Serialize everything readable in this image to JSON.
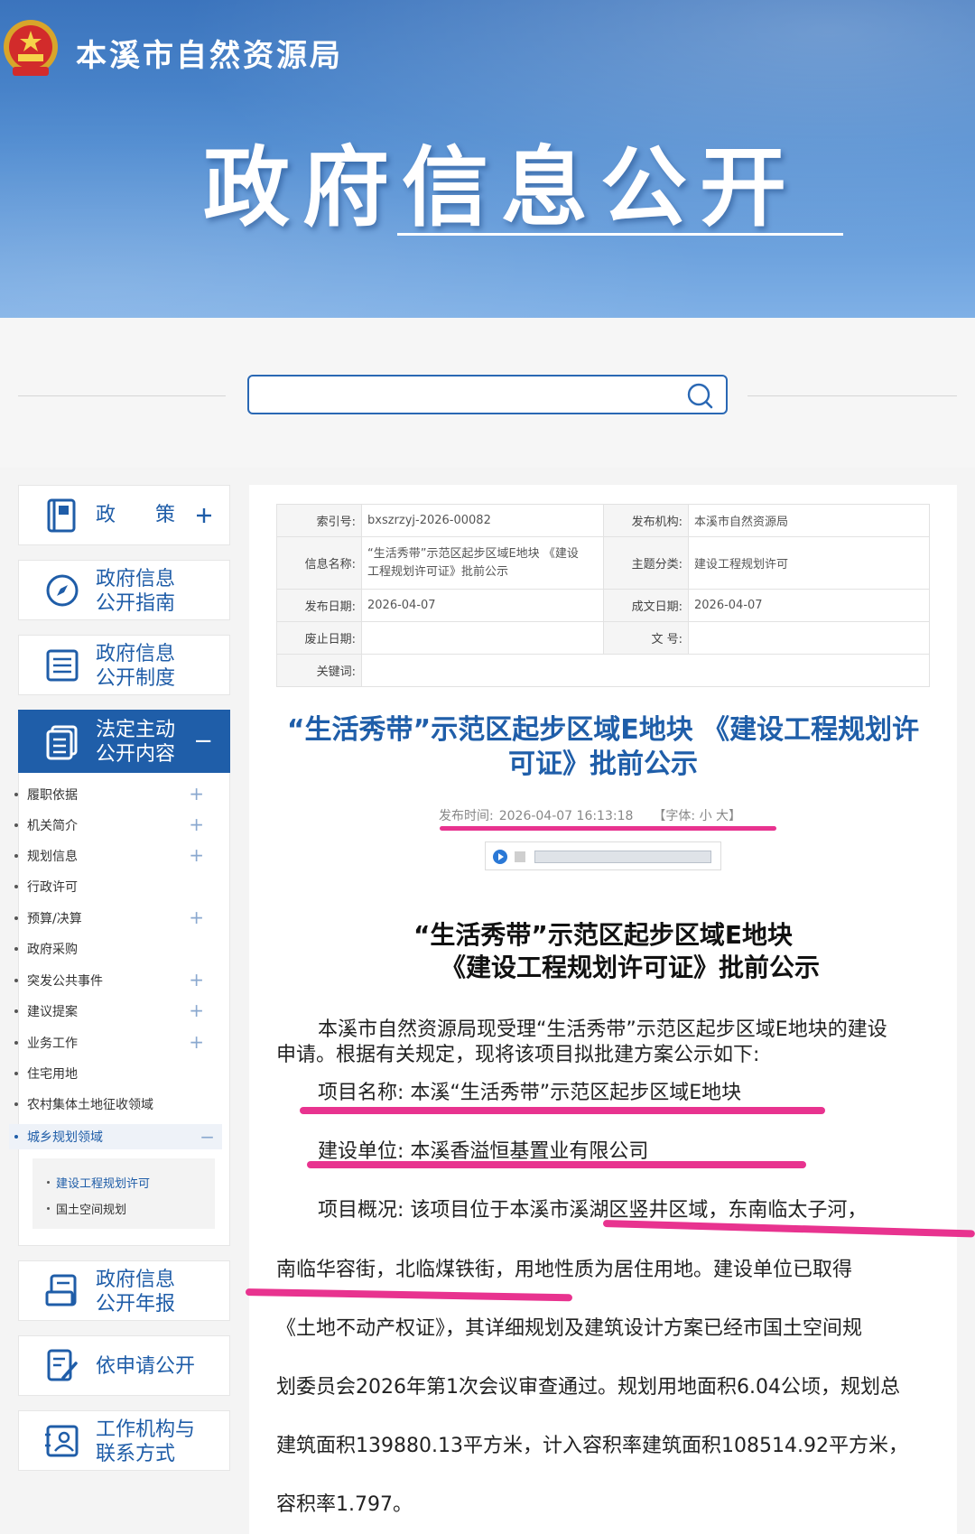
{
  "header": {
    "org_name": "本溪市自然资源局",
    "hero_title": "政府信息公开"
  },
  "search": {
    "placeholder": "",
    "value": ""
  },
  "sidebar": {
    "cards": [
      {
        "label_line1": "政　　策",
        "label_line2": "",
        "icon": "policy-book-icon",
        "toggle": "+"
      },
      {
        "label_line1": "政府信息",
        "label_line2": "公开指南",
        "icon": "compass-icon"
      },
      {
        "label_line1": "政府信息",
        "label_line2": "公开制度",
        "icon": "list-doc-icon"
      },
      {
        "label_line1": "法定主动",
        "label_line2": "公开内容",
        "icon": "docs-stack-icon",
        "toggle": "−"
      }
    ],
    "sub_items": [
      {
        "label": "履职依据",
        "toggle": "+"
      },
      {
        "label": "机关简介",
        "toggle": "+"
      },
      {
        "label": "规划信息",
        "toggle": "+"
      },
      {
        "label": "行政许可",
        "toggle": ""
      },
      {
        "label": "预算/决算",
        "toggle": "+"
      },
      {
        "label": "政府采购",
        "toggle": ""
      },
      {
        "label": "突发公共事件",
        "toggle": "+"
      },
      {
        "label": "建议提案",
        "toggle": "+"
      },
      {
        "label": "业务工作",
        "toggle": "+"
      },
      {
        "label": "住宅用地",
        "toggle": ""
      },
      {
        "label": "农村集体土地征收领域",
        "toggle": ""
      },
      {
        "label": "城乡规划领域",
        "toggle": "−"
      }
    ],
    "nested_items": [
      {
        "label": "建设工程规划许可"
      },
      {
        "label": "国土空间规划"
      }
    ],
    "bottom_cards": [
      {
        "label_line1": "政府信息",
        "label_line2": "公开年报",
        "icon": "report-icon"
      },
      {
        "label_line1": "依申请公开",
        "label_line2": "",
        "icon": "edit-doc-icon"
      },
      {
        "label_line1": "工作机构与",
        "label_line2": "联系方式",
        "icon": "contact-card-icon"
      }
    ]
  },
  "meta": {
    "index_label": "索引号:",
    "index_value": "bxszrzyj-2026-00082",
    "publisher_label": "发布机构:",
    "publisher_value": "本溪市自然资源局",
    "info_name_label": "信息名称:",
    "info_name_line1": "“生活秀带”示范区起步区域E地块 《建设",
    "info_name_line2": "工程规划许可证》批前公示",
    "topic_label": "主题分类:",
    "topic_value": "建设工程规划许可",
    "pub_date_label": "发布日期:",
    "pub_date_value": "2026-04-07",
    "doc_date_label": "成文日期:",
    "doc_date_value": "2026-04-07",
    "expire_label": "废止日期:",
    "expire_value": "",
    "doc_no_label": "文 号:",
    "doc_no_value": "",
    "keywords_label": "关键词:",
    "keywords_value": ""
  },
  "article": {
    "title_line1": "“生活秀带”示范区起步区域E地块 《建设工程规划许",
    "title_line2": "可证》批前公示",
    "pub_time_label": "发布时间:",
    "pub_time_value": "2026-04-07 16:13:18",
    "font_ctl": "【字体: 小 大】",
    "body_title_line1": "“生活秀带”示范区起步区域E地块",
    "body_title_line2": "《建设工程规划许可证》批前公示",
    "para1_line1": "本溪市自然资源局现受理“生活秀带”示范区起步区域E地块的建设",
    "para1_line2": "申请。根据有关规定，现将该项目拟批建方案公示如下:",
    "project_name": "项目名称: 本溪“生活秀带”示范区起步区域E地块",
    "builder": "建设单位: 本溪香溢恒基置业有限公司",
    "overview_line1": "项目概况: 该项目位于本溪市溪湖区竖井区域，东南临太子河，",
    "overview_line2": "南临华容街，北临煤铁街，用地性质为居住用地。建设单位已取得",
    "overview_line3": "《土地不动产权证》，其详细规划及建筑设计方案已经市国土空间规",
    "overview_line4": "划委员会2026年第1次会议审查通过。规划用地面积6.04公顷，规划总",
    "overview_line5": "建筑面积139880.13平方米，计入容积率建筑面积108514.92平方米，",
    "overview_line6": "容积率1.797。"
  },
  "colors": {
    "brand_blue": "#1f5ea9",
    "highlight_pink": "#e8338f"
  }
}
